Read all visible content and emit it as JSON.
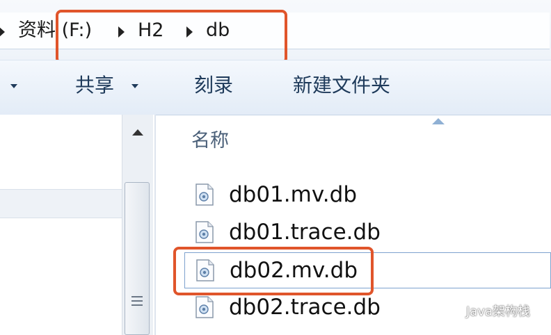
{
  "address_bar": {
    "crumbs": [
      "资料 (F:)",
      "H2",
      "db"
    ]
  },
  "toolbar": {
    "share_label": "共享",
    "burn_label": "刻录",
    "new_folder_label": "新建文件夹"
  },
  "file_list": {
    "column_name": "名称",
    "files": [
      "db01.mv.db",
      "db01.trace.db",
      "db02.mv.db",
      "db02.trace.db"
    ],
    "selected": "db02.mv.db"
  },
  "watermark": {
    "text": "Java架构栈"
  },
  "colors": {
    "highlight": "#e0552b",
    "selection_border": "#7da2ce"
  },
  "icons": [
    "chevron-right-icon",
    "dropdown-arrow-icon",
    "scroll-up-icon",
    "sort-arrow-icon",
    "db-file-icon",
    "wechat-icon"
  ]
}
